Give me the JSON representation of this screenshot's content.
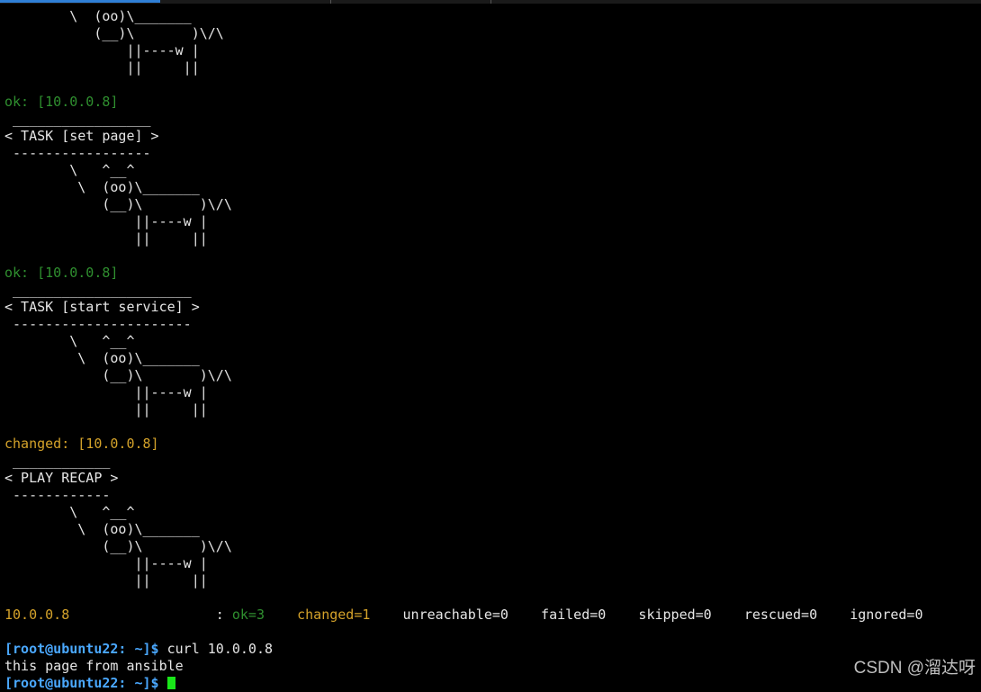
{
  "window": {
    "tabs": [
      "",
      "",
      ""
    ]
  },
  "terminal": {
    "lines": [
      {
        "type": "text",
        "text": "        \\  (oo)\\_______"
      },
      {
        "type": "text",
        "text": "           (__)\\       )\\/\\"
      },
      {
        "type": "text",
        "text": "               ||----w |"
      },
      {
        "type": "text",
        "text": "               ||     ||"
      },
      {
        "type": "text",
        "text": ""
      },
      {
        "type": "ok",
        "text": "ok: [10.0.0.8]"
      },
      {
        "type": "text",
        "text": " _________________"
      },
      {
        "type": "text",
        "text": "< TASK [set page] >"
      },
      {
        "type": "text",
        "text": " -----------------"
      },
      {
        "type": "text",
        "text": "        \\   ^__^"
      },
      {
        "type": "text",
        "text": "         \\  (oo)\\_______"
      },
      {
        "type": "text",
        "text": "            (__)\\       )\\/\\"
      },
      {
        "type": "text",
        "text": "                ||----w |"
      },
      {
        "type": "text",
        "text": "                ||     ||"
      },
      {
        "type": "text",
        "text": ""
      },
      {
        "type": "ok",
        "text": "ok: [10.0.0.8]"
      },
      {
        "type": "text",
        "text": " ______________________"
      },
      {
        "type": "text",
        "text": "< TASK [start service] >"
      },
      {
        "type": "text",
        "text": " ----------------------"
      },
      {
        "type": "text",
        "text": "        \\   ^__^"
      },
      {
        "type": "text",
        "text": "         \\  (oo)\\_______"
      },
      {
        "type": "text",
        "text": "            (__)\\       )\\/\\"
      },
      {
        "type": "text",
        "text": "                ||----w |"
      },
      {
        "type": "text",
        "text": "                ||     ||"
      },
      {
        "type": "text",
        "text": ""
      },
      {
        "type": "changed",
        "text": "changed: [10.0.0.8]"
      },
      {
        "type": "text",
        "text": " ____________"
      },
      {
        "type": "text",
        "text": "< PLAY RECAP >"
      },
      {
        "type": "text",
        "text": " ------------"
      },
      {
        "type": "text",
        "text": "        \\   ^__^"
      },
      {
        "type": "text",
        "text": "         \\  (oo)\\_______"
      },
      {
        "type": "text",
        "text": "            (__)\\       )\\/\\"
      },
      {
        "type": "text",
        "text": "                ||----w |"
      },
      {
        "type": "text",
        "text": "                ||     ||"
      },
      {
        "type": "text",
        "text": ""
      }
    ],
    "recap": {
      "host": "10.0.0.8",
      "sep": "                  : ",
      "ok": "ok=3",
      "gap1": "    ",
      "changed": "changed=1",
      "rest": "    unreachable=0    failed=0    skipped=0    rescued=0    ignored=0"
    },
    "blank_after_recap": "",
    "command_prompt": "[root@ubuntu22: ~]$",
    "command": " curl 10.0.0.8",
    "command_output": "this page from ansible",
    "final_prompt": "[root@ubuntu22: ~]$",
    "final_input": " "
  },
  "watermark": "CSDN @溜达呀",
  "colors": {
    "background": "#000000",
    "text": "#e6e6e6",
    "ok": "#2f8f2f",
    "changed": "#d4a22a",
    "prompt": "#4aa8ff",
    "cursor": "#19e619"
  }
}
